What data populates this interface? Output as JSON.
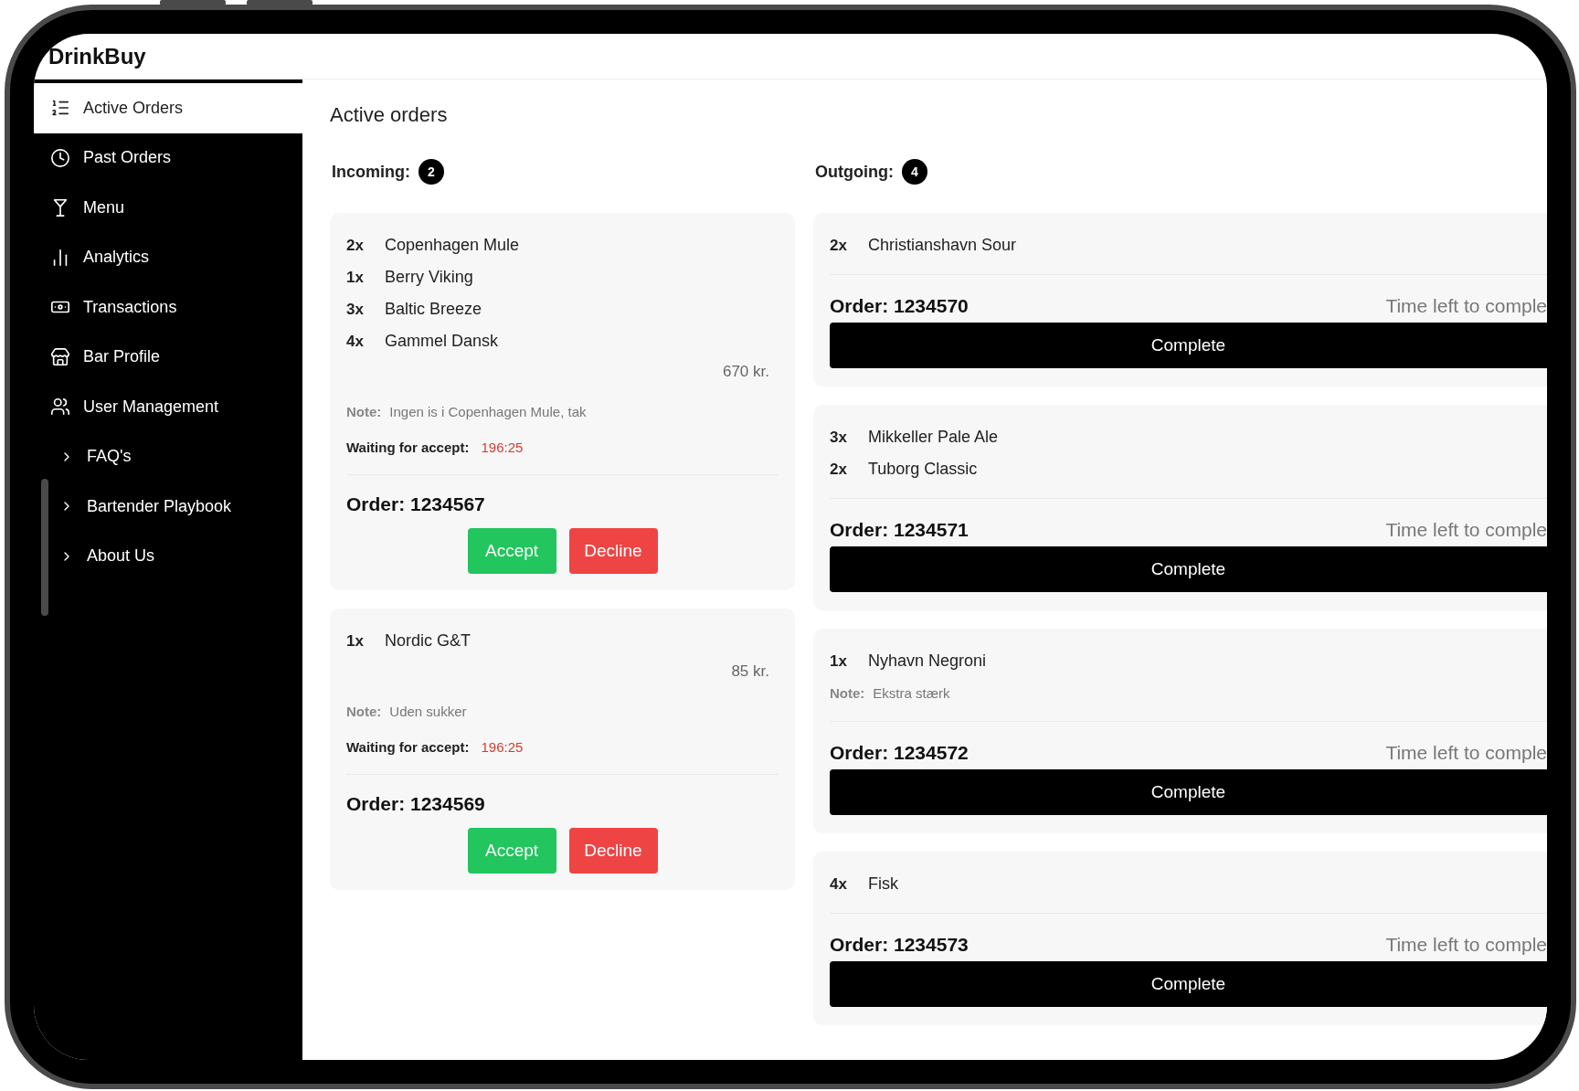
{
  "app": {
    "brand": "DrinkBuy"
  },
  "sidebar": {
    "items": [
      {
        "label": "Active Orders",
        "selected": true
      },
      {
        "label": "Past Orders",
        "selected": false
      },
      {
        "label": "Menu",
        "selected": false
      },
      {
        "label": "Analytics",
        "selected": false
      },
      {
        "label": "Transactions",
        "selected": false
      },
      {
        "label": "Bar Profile",
        "selected": false
      },
      {
        "label": "User Management",
        "selected": false
      },
      {
        "label": "FAQ's",
        "selected": false
      },
      {
        "label": "Bartender Playbook",
        "selected": false
      },
      {
        "label": "About Us",
        "selected": false
      }
    ]
  },
  "page": {
    "title": "Active orders"
  },
  "incoming": {
    "label": "Incoming:",
    "count": "2",
    "orders": [
      {
        "items": [
          {
            "qty": "2x",
            "name": "Copenhagen Mule"
          },
          {
            "qty": "1x",
            "name": "Berry Viking"
          },
          {
            "qty": "3x",
            "name": "Baltic Breeze"
          },
          {
            "qty": "4x",
            "name": "Gammel Dansk"
          }
        ],
        "price": "670 kr.",
        "note_label": "Note:",
        "note": "Ingen is i Copenhagen Mule, tak",
        "waiting_label": "Waiting for accept:",
        "timer": "196:25",
        "order": "Order: 1234567",
        "accept": "Accept",
        "decline": "Decline"
      },
      {
        "items": [
          {
            "qty": "1x",
            "name": "Nordic G&T"
          }
        ],
        "price": "85 kr.",
        "note_label": "Note:",
        "note": "Uden sukker",
        "waiting_label": "Waiting for accept:",
        "timer": "196:25",
        "order": "Order: 1234569",
        "accept": "Accept",
        "decline": "Decline"
      }
    ]
  },
  "outgoing": {
    "label": "Outgoing:",
    "count": "4",
    "orders": [
      {
        "items": [
          {
            "qty": "2x",
            "name": "Christianshavn Sour"
          }
        ],
        "order": "Order: 1234570",
        "time_left": "Time left to comple",
        "button": "Complete"
      },
      {
        "items": [
          {
            "qty": "3x",
            "name": "Mikkeller Pale Ale"
          },
          {
            "qty": "2x",
            "name": "Tuborg Classic"
          }
        ],
        "order": "Order: 1234571",
        "time_left": "Time left to comple",
        "button": "Complete"
      },
      {
        "items": [
          {
            "qty": "1x",
            "name": "Nyhavn Negroni"
          }
        ],
        "note_label": "Note:",
        "note": "Ekstra stærk",
        "order": "Order: 1234572",
        "time_left": "Time left to comple",
        "button": "Complete"
      },
      {
        "items": [
          {
            "qty": "4x",
            "name": "Fisk"
          }
        ],
        "order": "Order: 1234573",
        "time_left": "Time left to comple",
        "button": "Complete"
      }
    ]
  }
}
